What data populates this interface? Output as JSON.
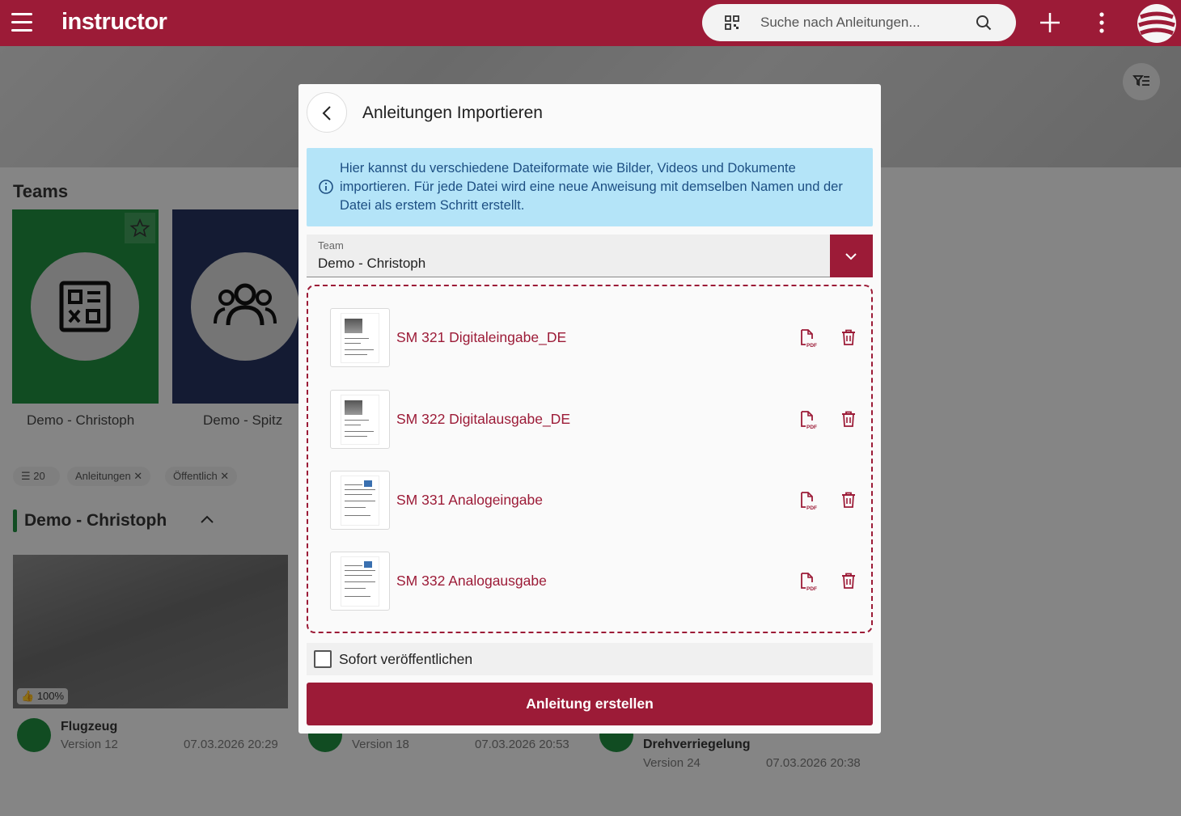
{
  "app": {
    "logo": "instructor"
  },
  "search": {
    "placeholder": "Suche nach Anleitungen..."
  },
  "teams_section": {
    "title": "Teams",
    "teams": [
      {
        "label": "Demo - Christoph",
        "color": "#1f8a3e",
        "icon": "qr-code-icon"
      },
      {
        "label": "Demo - Spitz",
        "color": "#26325e",
        "icon": "users-icon"
      }
    ]
  },
  "filters": {
    "count": "20",
    "chips": [
      "Anleitungen",
      "Öffentlich"
    ]
  },
  "group": {
    "title": "Demo - Christoph"
  },
  "instructions": [
    {
      "name": "Flugzeug",
      "version": "Version 12",
      "date": "07.03.2026 20:29",
      "likes": "100%"
    },
    {
      "name": "",
      "version": "Version 18",
      "date": "07.03.2026 20:53"
    },
    {
      "name": "Drehverriegelung",
      "version": "Version 24",
      "date": "07.03.2026 20:38"
    }
  ],
  "dialog": {
    "title": "Anleitungen Importieren",
    "info": "Hier kannst du verschiedene Dateiformate wie Bilder, Videos und Dokumente importieren. Für jede Datei wird eine neue Anweisung mit demselben Namen und der Datei als erstem Schritt erstellt.",
    "team_field": {
      "label": "Team",
      "value": "Demo - Christoph"
    },
    "files": [
      {
        "name": "SM 321 Digitaleingabe_DE",
        "type_icon": "pdf-icon"
      },
      {
        "name": "SM 322 Digitalausgabe_DE",
        "type_icon": "pdf-icon"
      },
      {
        "name": "SM 331 Analogeingabe",
        "type_icon": "pdf-icon"
      },
      {
        "name": "SM 332 Analogausgabe",
        "type_icon": "pdf-icon"
      }
    ],
    "publish": {
      "label": "Sofort veröffentlichen",
      "checked": false
    },
    "submit_label": "Anleitung erstellen"
  },
  "colors": {
    "brand": "#9c1b37",
    "info_bg": "#b4e4f8",
    "info_text": "#1d4f83",
    "team_green": "#1f8a3e",
    "team_navy": "#26325e"
  }
}
